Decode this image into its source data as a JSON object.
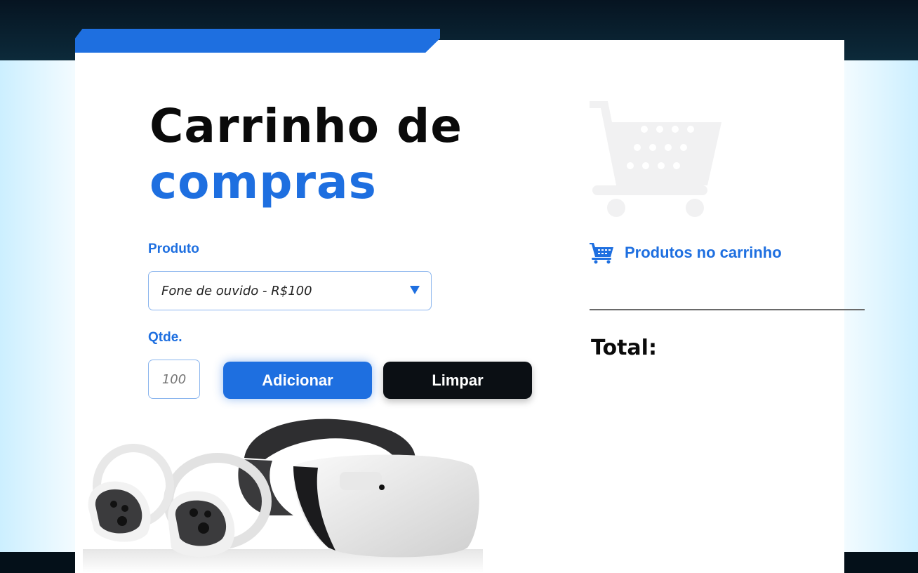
{
  "page": {
    "title_line1": "Carrinho de",
    "title_line2": "compras"
  },
  "form": {
    "product_label": "Produto",
    "product_selected": "Fone de ouvido - R$100",
    "qty_label": "Qtde.",
    "qty_placeholder": "100",
    "add_button": "Adicionar",
    "clear_button": "Limpar"
  },
  "cart": {
    "heading": "Produtos no carrinho",
    "total_label": "Total:"
  },
  "icons": {
    "large_cart": "shopping-cart-icon",
    "small_cart": "shopping-cart-icon",
    "dropdown": "triangle-down-icon"
  },
  "colors": {
    "accent": "#1e6fe0",
    "dark": "#0b0f14",
    "background_dark": "#071826"
  }
}
